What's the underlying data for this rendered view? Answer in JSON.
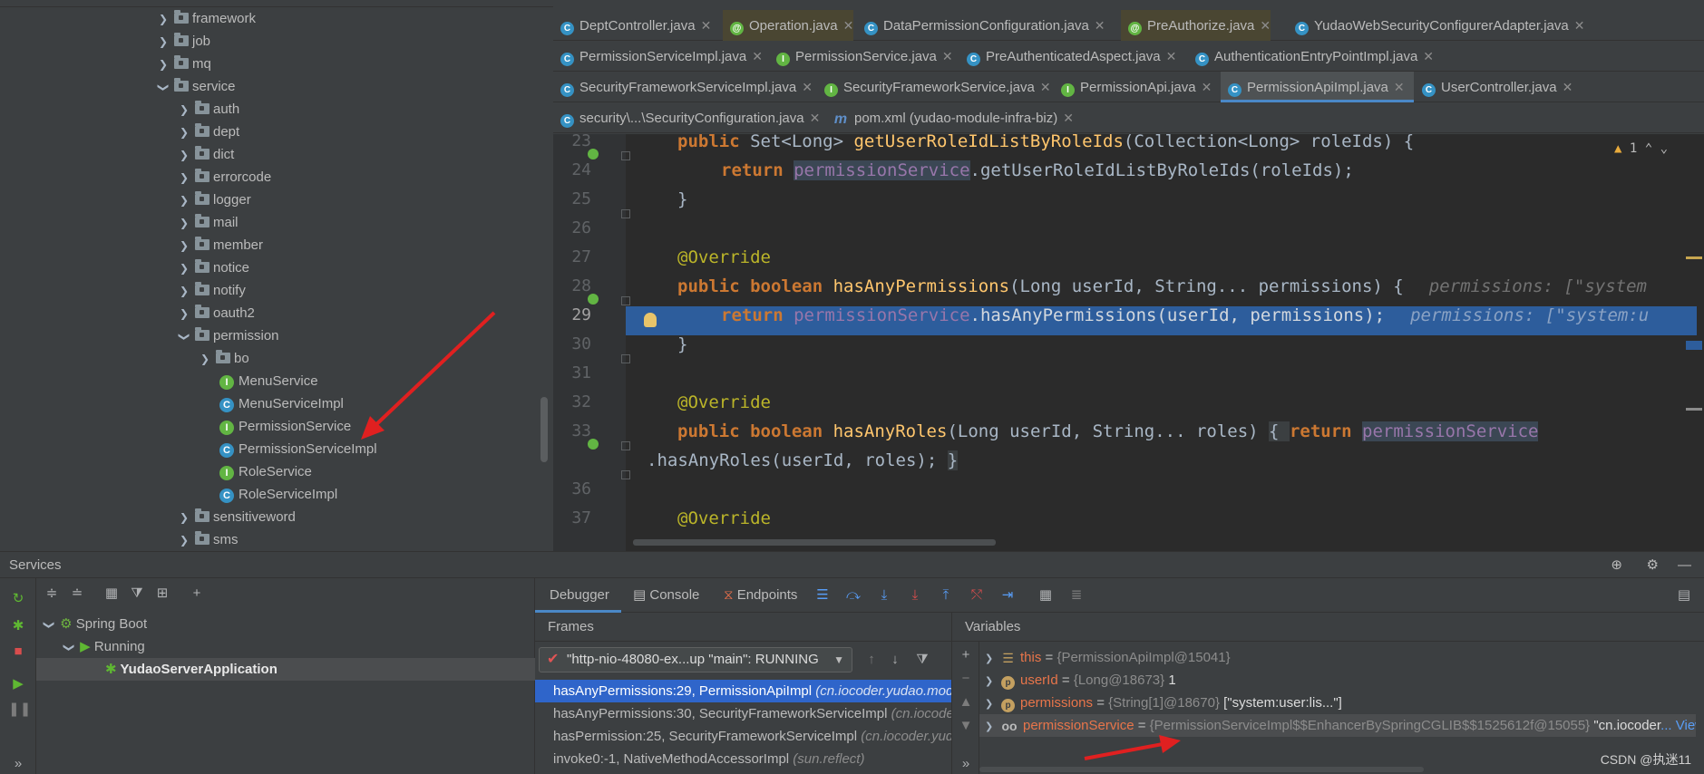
{
  "project_tree": {
    "items": [
      {
        "label": "framework",
        "type": "folder",
        "expanded": false
      },
      {
        "label": "job",
        "type": "folder",
        "expanded": false
      },
      {
        "label": "mq",
        "type": "folder",
        "expanded": false
      },
      {
        "label": "service",
        "type": "folder",
        "expanded": true
      },
      {
        "label": "auth",
        "type": "folder",
        "expanded": false
      },
      {
        "label": "dept",
        "type": "folder",
        "expanded": false
      },
      {
        "label": "dict",
        "type": "folder",
        "expanded": false
      },
      {
        "label": "errorcode",
        "type": "folder",
        "expanded": false
      },
      {
        "label": "logger",
        "type": "folder",
        "expanded": false
      },
      {
        "label": "mail",
        "type": "folder",
        "expanded": false
      },
      {
        "label": "member",
        "type": "folder",
        "expanded": false
      },
      {
        "label": "notice",
        "type": "folder",
        "expanded": false
      },
      {
        "label": "notify",
        "type": "folder",
        "expanded": false
      },
      {
        "label": "oauth2",
        "type": "folder",
        "expanded": false
      },
      {
        "label": "permission",
        "type": "folder",
        "expanded": true
      },
      {
        "label": "bo",
        "type": "folder",
        "expanded": false
      },
      {
        "label": "MenuService",
        "type": "interface"
      },
      {
        "label": "MenuServiceImpl",
        "type": "class"
      },
      {
        "label": "PermissionService",
        "type": "interface"
      },
      {
        "label": "PermissionServiceImpl",
        "type": "class"
      },
      {
        "label": "RoleService",
        "type": "interface"
      },
      {
        "label": "RoleServiceImpl",
        "type": "class"
      },
      {
        "label": "sensitiveword",
        "type": "folder",
        "expanded": false
      },
      {
        "label": "sms",
        "type": "folder",
        "expanded": false
      }
    ]
  },
  "editor_tabs": {
    "row1": [
      {
        "label": "DeptController.java",
        "icon": "class-icon"
      },
      {
        "label": "Operation.java",
        "icon": "annotation-icon"
      },
      {
        "label": "DataPermissionConfiguration.java",
        "icon": "class-icon"
      },
      {
        "label": "PreAuthorize.java",
        "icon": "annotation-icon"
      },
      {
        "label": "YudaoWebSecurityConfigurerAdapter.java",
        "icon": "class-icon"
      }
    ],
    "row2": [
      {
        "label": "PermissionServiceImpl.java",
        "icon": "class-icon"
      },
      {
        "label": "PermissionService.java",
        "icon": "interface-icon"
      },
      {
        "label": "PreAuthenticatedAspect.java",
        "icon": "class-icon"
      },
      {
        "label": "AuthenticationEntryPointImpl.java",
        "icon": "class-icon"
      }
    ],
    "row3": [
      {
        "label": "SecurityFrameworkServiceImpl.java",
        "icon": "class-icon"
      },
      {
        "label": "SecurityFrameworkService.java",
        "icon": "interface-icon"
      },
      {
        "label": "PermissionApi.java",
        "icon": "interface-icon"
      },
      {
        "label": "PermissionApiImpl.java",
        "icon": "class-icon",
        "active": true
      },
      {
        "label": "UserController.java",
        "icon": "class-icon"
      }
    ],
    "row4": [
      {
        "label": "security\\...\\SecurityConfiguration.java",
        "icon": "class-icon"
      },
      {
        "label": "pom.xml (yudao-module-infra-biz)",
        "icon": "maven-icon"
      }
    ]
  },
  "editor": {
    "warning_count": "1",
    "line_numbers": [
      "23",
      "24",
      "25",
      "26",
      "27",
      "28",
      "29",
      "30",
      "31",
      "32",
      "33",
      "",
      "36",
      "37"
    ],
    "lines": {
      "l23_a": "public ",
      "l23_b": "Set<Long> ",
      "l23_c": "getUserRoleIdListByRoleIds",
      "l23_d": "(Collection<Long> roleIds) {",
      "l24_a": "return ",
      "l24_b": "permissionService",
      "l24_c": ".getUserRoleIdListByRoleIds(roleIds);",
      "l25": "}",
      "l27": "@Override",
      "l28_a": "public ",
      "l28_b": "boolean ",
      "l28_c": "hasAnyPermissions",
      "l28_d": "(Long userId, String... permissions) {",
      "l28_hint": "permissions: [\"system",
      "l29_a": "return ",
      "l29_b": "permissionService",
      "l29_c": ".hasAnyPermissions(userId, permissions);",
      "l29_hint": "permissions: [\"system:u",
      "l30": "}",
      "l32": "@Override",
      "l33_a": "public ",
      "l33_b": "boolean ",
      "l33_c": "hasAnyRoles",
      "l33_d": "(Long userId, String... roles) ",
      "l33_e": "{ ",
      "l33_f": "return ",
      "l33_g": "permissionService",
      "l33_cont": ".hasAnyRoles(userId, roles); ",
      "l33_close": "}",
      "l37": "@Override"
    }
  },
  "services": {
    "title": "Services",
    "tree": [
      {
        "label": "Spring Boot",
        "level": 0
      },
      {
        "label": "Running",
        "level": 1
      },
      {
        "label": "YudaoServerApplication",
        "level": 2,
        "selected": true
      }
    ]
  },
  "debugger": {
    "tabs": [
      "Debugger",
      "Console",
      "Endpoints"
    ],
    "frames_title": "Frames",
    "thread": "\"http-nio-48080-ex...up \"main\": RUNNING",
    "frames": [
      {
        "method": "hasAnyPermissions:29, PermissionApiImpl ",
        "pkg": "(cn.iocoder.yudao.mod",
        "selected": true
      },
      {
        "method": "hasAnyPermissions:30, SecurityFrameworkServiceImpl ",
        "pkg": "(cn.iocoder"
      },
      {
        "method": "hasPermission:25, SecurityFrameworkServiceImpl ",
        "pkg": "(cn.iocoder.yuda"
      },
      {
        "method": "invoke0:-1, NativeMethodAccessorImpl ",
        "pkg": "(sun.reflect)"
      }
    ],
    "variables_title": "Variables",
    "variables": [
      {
        "name": "this",
        "eq": " = ",
        "val": "{PermissionApiImpl@15041}",
        "extra": ""
      },
      {
        "name": "userId",
        "eq": " = ",
        "val": "{Long@18673} ",
        "extra": "1"
      },
      {
        "name": "permissions",
        "eq": " = ",
        "val": "{String[1]@18670} ",
        "extra": "[\"system:user:lis...\"]"
      },
      {
        "name": "permissionService",
        "eq": " = ",
        "val": "{PermissionServiceImpl$$EnhancerBySpringCGLIB$$1525612f@15055} ",
        "extra": "\"cn.iocoder",
        "link": "... View"
      }
    ]
  },
  "watermark": "CSDN @执迷11",
  "colors": {
    "panel": "#3c3f41",
    "editor_bg": "#2b2b2b",
    "keyword": "#cc7832",
    "method": "#ffc66d",
    "field": "#9876aa",
    "annotation": "#bbb529",
    "current_line": "#2d5d9c",
    "selection": "#2f65ca",
    "arrow": "#e02020"
  }
}
